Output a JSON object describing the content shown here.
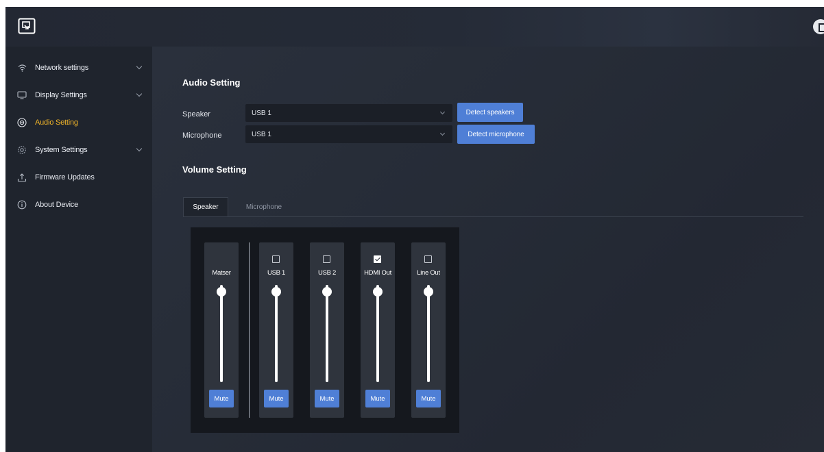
{
  "sidebar": {
    "items": [
      {
        "label": "Network settings",
        "icon": "wifi-icon",
        "expandable": true,
        "active": false
      },
      {
        "label": "Display Settings",
        "icon": "monitor-icon",
        "expandable": true,
        "active": false
      },
      {
        "label": "Audio Setting",
        "icon": "speaker-icon",
        "expandable": false,
        "active": true
      },
      {
        "label": "System Settings",
        "icon": "gear-icon",
        "expandable": true,
        "active": false
      },
      {
        "label": "Firmware Updates",
        "icon": "upload-icon",
        "expandable": false,
        "active": false
      },
      {
        "label": "About Device",
        "icon": "info-icon",
        "expandable": false,
        "active": false
      }
    ]
  },
  "audio": {
    "title": "Audio Setting",
    "speaker_label": "Speaker",
    "speaker_value": "USB 1",
    "detect_speakers": "Detect speakers",
    "microphone_label": "Microphone",
    "microphone_value": "USB 1",
    "detect_microphone": "Detect microphone"
  },
  "volume": {
    "title": "Volume Setting",
    "tabs": [
      {
        "label": "Speaker",
        "active": true
      },
      {
        "label": "Microphone",
        "active": false
      }
    ],
    "channels": [
      {
        "label": "Matser",
        "has_checkbox": false,
        "checked": false,
        "level": 0.95,
        "mute_label": "Mute"
      },
      {
        "label": "USB 1",
        "has_checkbox": true,
        "checked": false,
        "level": 0.95,
        "mute_label": "Mute"
      },
      {
        "label": "USB 2",
        "has_checkbox": true,
        "checked": false,
        "level": 0.95,
        "mute_label": "Mute"
      },
      {
        "label": "HDMI Out",
        "has_checkbox": true,
        "checked": true,
        "level": 0.95,
        "mute_label": "Mute"
      },
      {
        "label": "Line Out",
        "has_checkbox": true,
        "checked": false,
        "level": 0.95,
        "mute_label": "Mute"
      }
    ]
  },
  "colors": {
    "accent": "#4f7fd6",
    "active_menu": "#f0b429",
    "background": "#20252f"
  }
}
